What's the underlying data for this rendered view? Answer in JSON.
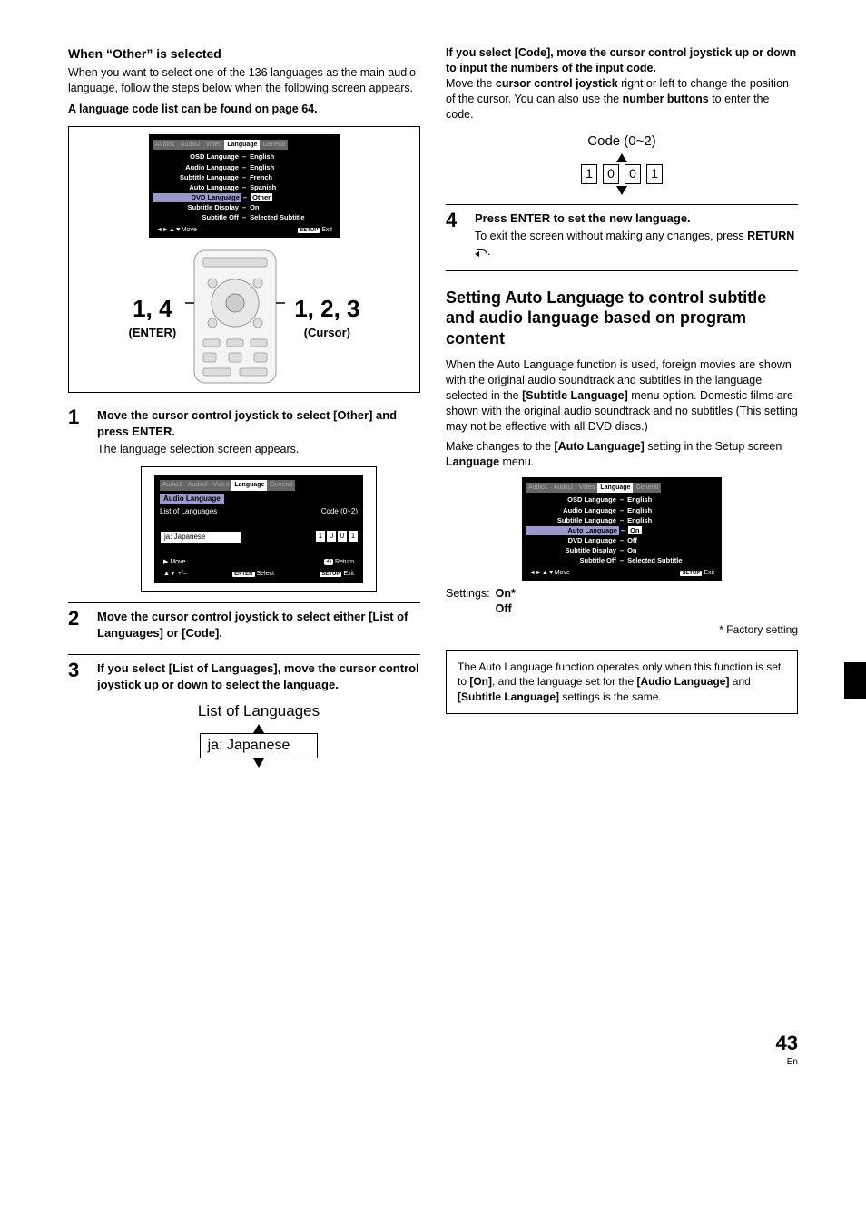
{
  "left": {
    "h3": "When “Other” is selected",
    "intro": "When you want to select one of the 136 languages as the main audio language, follow the steps below when the following screen appears.",
    "note": "A language code list can be found on page 64.",
    "osd": {
      "tabs": [
        "Audio1",
        "Audio2",
        "Video",
        "Language",
        "General"
      ],
      "rows": [
        {
          "k": "OSD Language",
          "v": "English"
        },
        {
          "k": "Audio Language",
          "v": "English"
        },
        {
          "k": "Subtitle Language",
          "v": "French"
        },
        {
          "k": "Auto Language",
          "v": "Spanish"
        },
        {
          "k": "DVD Language",
          "v": "Other",
          "hl": true
        },
        {
          "k": "Subtitle Display",
          "v": "On"
        },
        {
          "k": "Subtitle Off",
          "v": "Selected Subtitle"
        }
      ],
      "footer_move": "Move",
      "footer_setup": "SETUP",
      "footer_exit": "Exit"
    },
    "callout_left_big": "1, 4",
    "callout_left_sub": "(ENTER)",
    "callout_right_big": "1, 2, 3",
    "callout_right_sub": "(Cursor)",
    "step1": {
      "title": "Move the cursor control joystick to select [Other] and press ENTER.",
      "text": "The language selection screen appears."
    },
    "osd2": {
      "tabs": [
        "Audio1",
        "Audio2",
        "Video",
        "Language",
        "General"
      ],
      "hdr": "Audio Language",
      "list_label": "List of Languages",
      "code_label": "Code (0~2)",
      "dropdown": "ja: Japanese",
      "codes": [
        "1",
        "0",
        "0",
        "1"
      ],
      "move": "Move",
      "plus": "+/–",
      "enter": "ENTER",
      "select": "Select",
      "setup": "SETUP",
      "exit": "Exit",
      "return": "Return"
    },
    "step2": {
      "title": "Move the cursor control joystick to select either [List of Languages] or [Code]."
    },
    "step3": {
      "title": "If you select [List of Languages], move the cursor control joystick up or down to select the language.",
      "lol_title": "List of Languages",
      "lol_value": "ja: Japanese"
    }
  },
  "right": {
    "codeblock": {
      "h": "If you select [Code], move the cursor control joystick up or down to input the numbers of the input code.",
      "p_a": "Move the ",
      "p_b": "cursor control joystick",
      "p_c": " right or left to change the position of the cursor. You can also use the ",
      "p_d": "number buttons",
      "p_e": " to enter the code.",
      "fig_label": "Code (0~2)",
      "codes": [
        "1",
        "0",
        "0",
        "1"
      ]
    },
    "step4": {
      "title": "Press ENTER to set the new language.",
      "text_a": "To exit the screen without making any changes, press ",
      "text_b": "RETURN",
      "text_c": "."
    },
    "topic": "Setting Auto Language to control subtitle and audio language based on program content",
    "para_a": "When the Auto Language function is used, foreign movies are shown with the original audio soundtrack and subtitles in the language selected in the ",
    "para_b": "[Subtitle Language]",
    "para_c": " menu option. Domestic films are shown with the original audio soundtrack and no subtitles (This setting may not be effective with all DVD discs.)",
    "para_d": "Make changes to the ",
    "para_e": "[Auto Language]",
    "para_f": " setting in the Setup screen ",
    "para_g": "Language",
    "para_h": " menu.",
    "osd3": {
      "tabs": [
        "Audio1",
        "Audio2",
        "Video",
        "Language",
        "General"
      ],
      "rows": [
        {
          "k": "OSD Language",
          "v": "English"
        },
        {
          "k": "Audio Language",
          "v": "English"
        },
        {
          "k": "Subtitle Language",
          "v": "English"
        },
        {
          "k": "Auto Language",
          "v": "On",
          "hl": true
        },
        {
          "k": "DVD Language",
          "v": "Off"
        },
        {
          "k": "Subtitle Display",
          "v": "On"
        },
        {
          "k": "Subtitle Off",
          "v": "Selected Subtitle"
        }
      ],
      "footer_move": "Move",
      "footer_setup": "SETUP",
      "footer_exit": "Exit"
    },
    "settings_label": "Settings:",
    "settings_on": "On*",
    "settings_off": "Off",
    "factory": "* Factory setting",
    "notebox_a": "The Auto Language function operates only when this function is set to ",
    "notebox_b": "[On]",
    "notebox_c": ", and the language set for the ",
    "notebox_d": "[Audio Language]",
    "notebox_e": " and ",
    "notebox_f": "[Subtitle Language]",
    "notebox_g": " settings is the same."
  },
  "page": {
    "num": "43",
    "lang": "En"
  }
}
